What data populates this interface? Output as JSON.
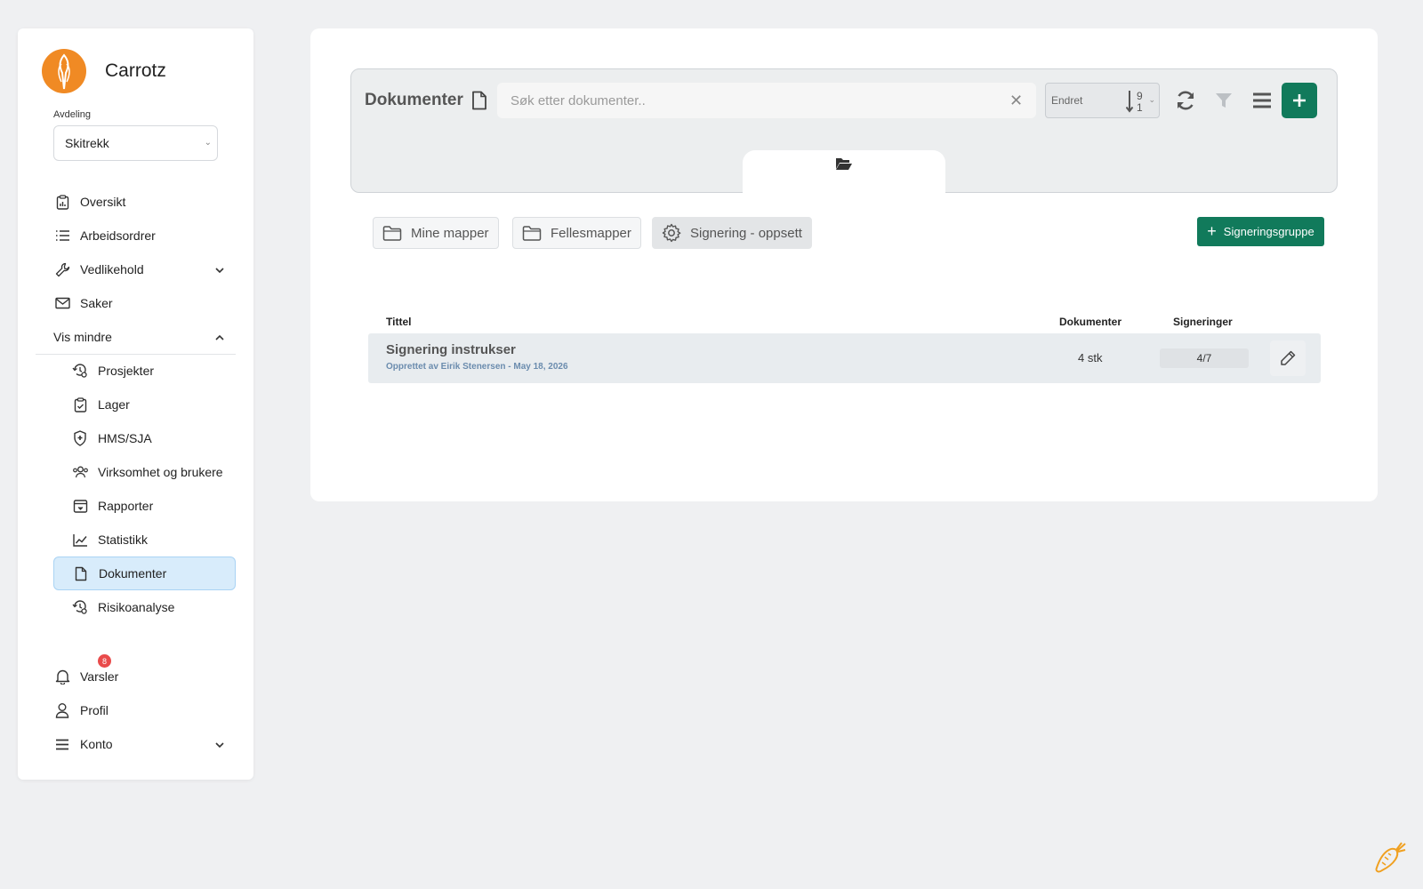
{
  "brand": {
    "name": "Carrotz",
    "accent": "#f08a24"
  },
  "department": {
    "label": "Avdeling",
    "selected": "Skitrekk"
  },
  "nav": {
    "oversikt": "Oversikt",
    "arbeidsordrer": "Arbeidsordrer",
    "vedlikehold": "Vedlikehold",
    "saker": "Saker",
    "vis_mindre": "Vis mindre",
    "prosjekter": "Prosjekter",
    "lager": "Lager",
    "hms": "HMS/SJA",
    "virksomhet": "Virksomhet og brukere",
    "rapporter": "Rapporter",
    "statistikk": "Statistikk",
    "dokumenter": "Dokumenter",
    "risikoanalyse": "Risikoanalyse",
    "varsler": "Varsler",
    "varsler_count": "8",
    "profil": "Profil",
    "konto": "Konto"
  },
  "toolbar": {
    "title": "Dokumenter",
    "search_placeholder": "Søk etter dokumenter..",
    "sort_label": "Endret",
    "sort_top": "9",
    "sort_bottom": "1"
  },
  "filters": {
    "mine_mapper": "Mine mapper",
    "fellesmapper": "Fellesmapper",
    "signering": "Signering - oppsett",
    "add_group": "Signeringsgruppe"
  },
  "table": {
    "headers": {
      "tittel": "Tittel",
      "dokumenter": "Dokumenter",
      "signeringer": "Signeringer"
    },
    "rows": [
      {
        "title": "Signering instrukser",
        "subtitle": "Opprettet av Eirik  Stenersen - May 18, 2026",
        "documents": "4 stk",
        "signatures": "4/7"
      }
    ]
  },
  "colors": {
    "primary_green": "#117a5b",
    "active_nav_bg": "#d8ecfb",
    "badge_red": "#e94b4b"
  }
}
